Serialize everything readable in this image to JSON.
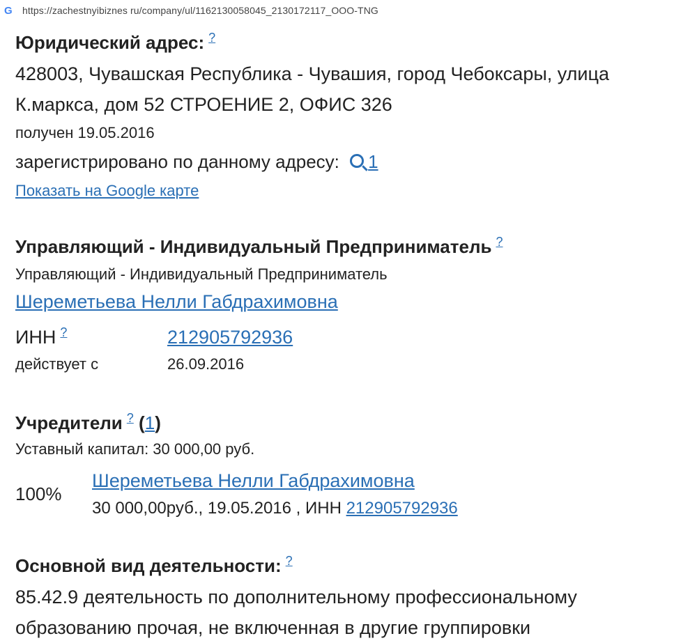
{
  "browser": {
    "url": "https://zachestnyibiznes ru/company/ul/1162130058045_2130172117_OOO-TNG"
  },
  "legal_address": {
    "heading": "Юридический адрес:",
    "help": "?",
    "line1": "428003, Чувашская Республика - Чувашия, город Чебоксары, улица",
    "line2": "К.маркса, дом 52 СТРОЕНИЕ 2, ОФИС 326",
    "received": "получен 19.05.2016",
    "registered_label": "зарегистрировано по данному адресу:",
    "registered_count": "1",
    "map_link": "Показать на Google карте"
  },
  "manager": {
    "heading": "Управляющий - Индивидуальный Предприниматель",
    "help": "?",
    "role": "Управляющий - Индивидуальный Предприниматель",
    "name": "Шереметьева Нелли Габдрахимовна",
    "inn_label": "ИНН",
    "inn_help": "?",
    "inn_value": "212905792936",
    "since_label": "действует с",
    "since_value": "26.09.2016"
  },
  "founders": {
    "heading": "Учредители",
    "help": "?",
    "count_open": "(",
    "count": "1",
    "count_close": ")",
    "capital": "Уставный капитал: 30 000,00 руб.",
    "items": [
      {
        "share": "100%",
        "name": "Шереметьева Нелли Габдрахимовна",
        "details": "30 000,00руб., 19.05.2016 , ИНН",
        "inn": "212905792936"
      }
    ]
  },
  "activity": {
    "heading": "Основной вид деятельности:",
    "help": "?",
    "line1": "85.42.9 деятельность по дополнительному профессиональному",
    "line2": "образованию прочая, не включенная в другие группировки"
  }
}
